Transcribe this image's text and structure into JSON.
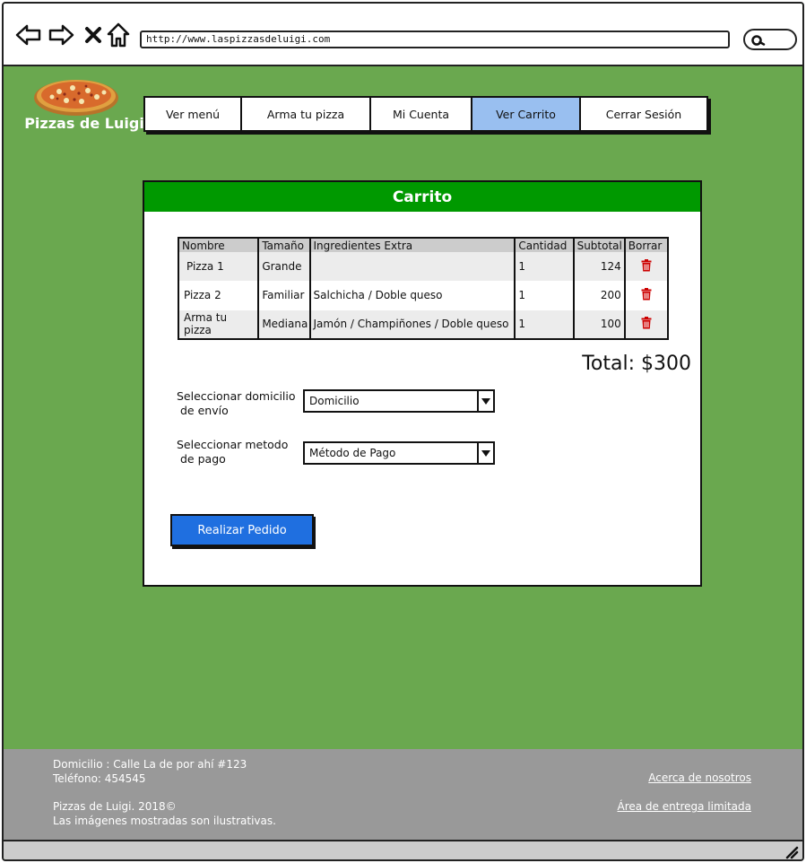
{
  "browser": {
    "url": "http://www.laspizzasdeluigi.com"
  },
  "header": {
    "brand": "Pizzas de Luigi",
    "nav": [
      {
        "label": "Ver menú",
        "active": false
      },
      {
        "label": "Arma tu pizza",
        "active": false
      },
      {
        "label": "Mi Cuenta",
        "active": false
      },
      {
        "label": "Ver Carrito",
        "active": true
      },
      {
        "label": "Cerrar Sesión",
        "active": false
      }
    ]
  },
  "cart": {
    "title": "Carrito",
    "columns": [
      "Nombre",
      "Tamaño",
      "Ingredientes Extra",
      "Cantidad",
      "Subtotal",
      "Borrar"
    ],
    "rows": [
      {
        "nombre": "Pizza 1",
        "tamano": "Grande",
        "ingredientes": "",
        "cantidad": "1",
        "subtotal": "124"
      },
      {
        "nombre": "Pizza 2",
        "tamano": "Familiar",
        "ingredientes": "Salchicha / Doble queso",
        "cantidad": "1",
        "subtotal": "200"
      },
      {
        "nombre": "Arma tu pizza",
        "tamano": "Mediana",
        "ingredientes": "Jamón / Champiñones / Doble queso",
        "cantidad": "1",
        "subtotal": "100"
      }
    ],
    "total": "Total: $300",
    "address_label_1": "Seleccionar domicilio",
    "address_label_2": "de envío",
    "address_value": "Domicilio",
    "payment_label_1": "Seleccionar metodo",
    "payment_label_2": "de pago",
    "payment_value": "Método de Pago",
    "submit": "Realizar Pedido"
  },
  "footer": {
    "address": "Domicilio : Calle La de por ahí #123",
    "phone": "Teléfono: 454545",
    "copyright": "Pizzas de Luigi. 2018©",
    "disclaimer": "Las imágenes mostradas son ilustrativas.",
    "about_link": "Acerca de nosotros",
    "delivery_link": "Área de entrega limitada"
  },
  "colors": {
    "page_bg": "#6aa84f",
    "panel_header": "#009900",
    "active_tab": "#99bff0",
    "submit_button": "#1f6fe0",
    "trash_icon": "#cc0000",
    "footer": "#999999"
  },
  "icons": [
    "back-arrow-icon",
    "forward-arrow-icon",
    "close-icon",
    "home-icon",
    "search-icon",
    "trash-icon",
    "chevron-down-icon",
    "resize-grip-icon",
    "pizza-logo"
  ]
}
